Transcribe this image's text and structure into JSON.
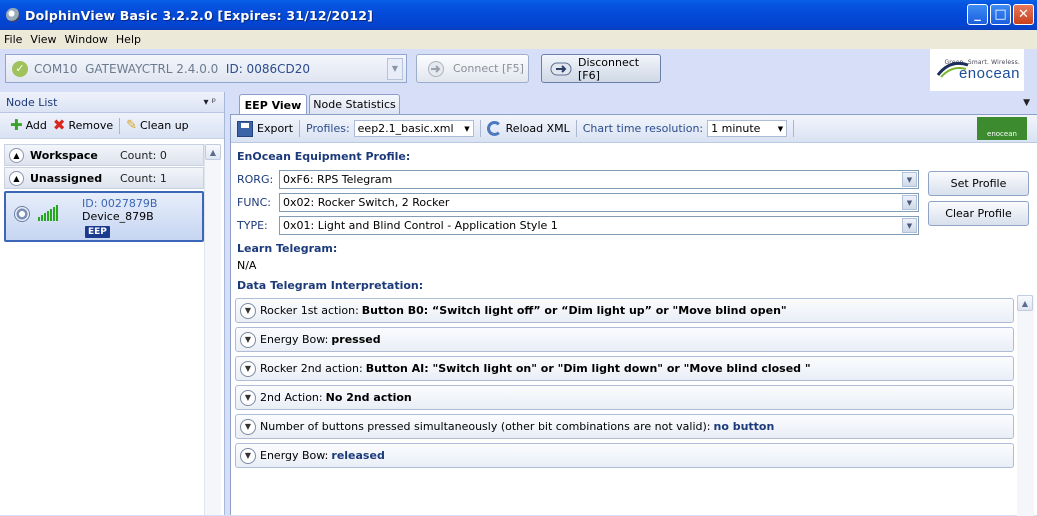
{
  "window": {
    "title": "DolphinView Basic 3.2.2.0  [Expires: 31/12/2012]",
    "minimize": "_",
    "maximize": "□",
    "close": "✕"
  },
  "menu": [
    "File",
    "View",
    "Window",
    "Help"
  ],
  "connection": {
    "port": "COM10",
    "gateway": "GATEWAYCTRL 2.4.0.0",
    "id": "ID: 0086CD20",
    "connect_label": "Connect [F5]",
    "disconnect_label": "Disconnect [F6]",
    "status_color": "#9fc25c"
  },
  "logo": {
    "tagline": "Green. Smart. Wireless.",
    "name": "enocean"
  },
  "node_list": {
    "title": "Node List",
    "pin": "▾  ᵖ",
    "add_label": "Add",
    "remove_label": "Remove",
    "cleanup_label": "Clean up",
    "groups": [
      {
        "name": "Workspace",
        "count": "Count: 0"
      },
      {
        "name": "Unassigned",
        "count": "Count: 1"
      }
    ],
    "device": {
      "id": "ID: 0027879B",
      "name": "Device_879B",
      "badge": "EEP"
    }
  },
  "tabs": {
    "active": "EEP View",
    "inactive": "Node Statistics"
  },
  "toolbar": {
    "export_label": "Export",
    "profiles_label": "Profiles:",
    "profiles_value": "eep2.1_basic.xml",
    "reload_label": "Reload XML",
    "chart_label": "Chart time resolution:",
    "chart_value": "1 minute",
    "mini_logo": "enocean"
  },
  "eep": {
    "section_title": "EnOcean Equipment Profile:",
    "rorg_label": "RORG:",
    "rorg_value": "0xF6: RPS Telegram",
    "func_label": "FUNC:",
    "func_value": "0x02: Rocker Switch, 2 Rocker",
    "type_label": "TYPE:",
    "type_value": "0x01: Light and Blind Control - Application Style 1",
    "set_profile": "Set Profile",
    "clear_profile": "Clear Profile"
  },
  "learn": {
    "title": "Learn Telegram:",
    "value": "N/A"
  },
  "interpretation": {
    "title": "Data Telegram Interpretation:",
    "rows": [
      {
        "label": "Rocker 1st action:",
        "value": "Button B0: “Switch light off” or “Dim light up” or \"Move blind open\""
      },
      {
        "label": "Energy Bow:",
        "value": "pressed"
      },
      {
        "label": "Rocker 2nd action:",
        "value": "Button AI:  \"Switch light on\" or \"Dim light down\" or \"Move blind closed \""
      },
      {
        "label": "2nd Action:",
        "value": "No 2nd action"
      },
      {
        "label": "Number of buttons pressed simultaneously (other bit combinations are not valid):",
        "value": "no button"
      },
      {
        "label": "Energy Bow:",
        "value": "released"
      }
    ]
  }
}
